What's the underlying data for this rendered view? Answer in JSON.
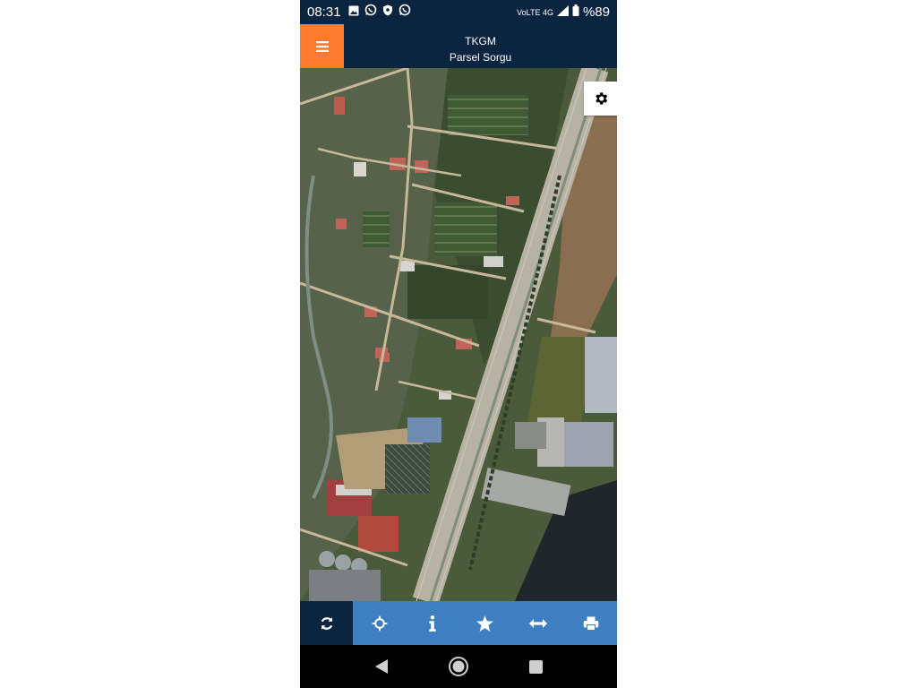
{
  "status_bar": {
    "time": "08:31",
    "left_icons": [
      "gallery-icon",
      "whatsapp-icon",
      "shield-icon",
      "whatsapp-icon"
    ],
    "network_label": "VoLTE 4G",
    "battery": "%89"
  },
  "header": {
    "title": "TKGM",
    "subtitle": "Parsel Sorgu",
    "background": "#0b2440",
    "menu_color": "#ff7a2f"
  },
  "map": {
    "type": "satellite",
    "settings_icon": "gear-icon"
  },
  "toolbar": {
    "background": "#3d7fc1",
    "active_background": "#0b2440",
    "items": [
      {
        "icon": "refresh-icon",
        "active": true
      },
      {
        "icon": "crosshair-icon",
        "active": false
      },
      {
        "icon": "info-icon",
        "active": false
      },
      {
        "icon": "star-icon",
        "active": false
      },
      {
        "icon": "measure-icon",
        "active": false
      },
      {
        "icon": "print-icon",
        "active": false
      }
    ]
  },
  "system_nav": {
    "items": [
      "back-icon",
      "home-icon",
      "recents-icon"
    ]
  }
}
